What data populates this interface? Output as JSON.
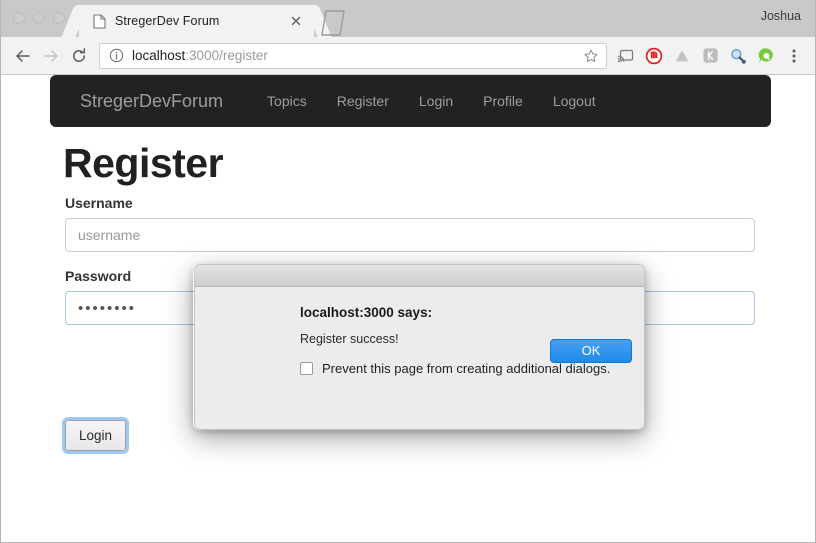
{
  "browser": {
    "profile_name": "Joshua",
    "tab": {
      "title": "StregerDev Forum",
      "page_icon": "page-icon",
      "close_icon": "close-icon"
    },
    "new_tab_icon": "new-tab-icon",
    "toolbar": {
      "back_icon": "back-arrow-icon",
      "forward_icon": "forward-arrow-icon",
      "reload_icon": "reload-icon",
      "info_icon": "info-circle-icon",
      "url_host": "localhost",
      "url_path": ":3000/register",
      "bookmark_icon": "star-icon",
      "menu_icon": "three-dot-menu-icon",
      "extensions": [
        {
          "name": "cast-icon",
          "color": "#7a7a7a"
        },
        {
          "name": "block-stop-icon",
          "color": "#e02020"
        },
        {
          "name": "google-drive-icon",
          "color": "#b7b7b7"
        },
        {
          "name": "keybase-icon",
          "color": "#9b9b9b"
        },
        {
          "name": "magnifier-icon",
          "color": "#6c9fd1"
        },
        {
          "name": "quora-icon",
          "color": "#7ac943"
        }
      ]
    }
  },
  "page": {
    "navbar": {
      "brand": "StregerDevForum",
      "background": "#222222",
      "link_color": "#9d9d9d",
      "links": [
        {
          "label": "Topics"
        },
        {
          "label": "Register"
        },
        {
          "label": "Login"
        },
        {
          "label": "Profile"
        },
        {
          "label": "Logout"
        }
      ]
    },
    "heading": "Register",
    "form": {
      "username_label": "Username",
      "username_placeholder": "username",
      "username_value": "",
      "password_label": "Password",
      "password_value": "••••••••",
      "submit_label": "Login",
      "focus_color": "#9ec9f5"
    }
  },
  "dialog": {
    "heading": "localhost:3000 says:",
    "message": "Register success!",
    "checkbox_label": "Prevent this page from creating additional dialogs.",
    "checkbox_checked": false,
    "ok_label": "OK",
    "ok_color": "#1d8ceb"
  }
}
